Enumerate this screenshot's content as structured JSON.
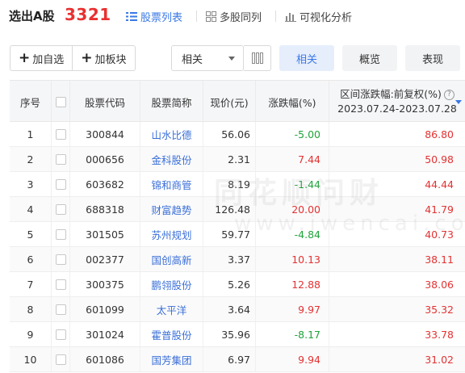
{
  "header": {
    "title": "选出A股",
    "count": "3321",
    "tabs": [
      {
        "label": "股票列表",
        "icon": "list-icon",
        "active": true
      },
      {
        "label": "多股同列",
        "icon": "grid-icon",
        "active": false
      },
      {
        "label": "可视化分析",
        "icon": "bar-chart-icon",
        "active": false
      }
    ]
  },
  "toolbar": {
    "add_watchlist": "加自选",
    "add_sector": "加板块",
    "select_value": "相关",
    "views": [
      "相关",
      "概览",
      "表现"
    ],
    "active_view": "相关"
  },
  "table": {
    "columns": [
      "序号",
      "",
      "股票代码",
      "股票简称",
      "现价(元)",
      "涨跌幅(%)",
      "区间涨跌幅:前复权(%)",
      "2023.07.24-2023.07.28"
    ],
    "rows": [
      {
        "idx": "1",
        "code": "300844",
        "name": "山水比德",
        "price": "56.06",
        "change": "-5.00",
        "range": "86.80"
      },
      {
        "idx": "2",
        "code": "000656",
        "name": "金科股份",
        "price": "2.31",
        "change": "7.44",
        "range": "50.98"
      },
      {
        "idx": "3",
        "code": "603682",
        "name": "锦和商管",
        "price": "8.19",
        "change": "-1.44",
        "range": "44.44"
      },
      {
        "idx": "4",
        "code": "688318",
        "name": "财富趋势",
        "price": "126.48",
        "change": "20.00",
        "range": "41.79"
      },
      {
        "idx": "5",
        "code": "301505",
        "name": "苏州规划",
        "price": "59.77",
        "change": "-4.84",
        "range": "40.73"
      },
      {
        "idx": "6",
        "code": "002377",
        "name": "国创高新",
        "price": "3.37",
        "change": "10.13",
        "range": "38.11"
      },
      {
        "idx": "7",
        "code": "300375",
        "name": "鹏翎股份",
        "price": "5.26",
        "change": "12.88",
        "range": "38.06"
      },
      {
        "idx": "8",
        "code": "601099",
        "name": "太平洋",
        "price": "3.64",
        "change": "9.97",
        "range": "35.32"
      },
      {
        "idx": "9",
        "code": "301024",
        "name": "霍普股份",
        "price": "35.96",
        "change": "-8.17",
        "range": "33.78"
      },
      {
        "idx": "10",
        "code": "601086",
        "name": "国芳集团",
        "price": "6.97",
        "change": "9.94",
        "range": "31.02"
      }
    ]
  },
  "watermark": {
    "line1": "同花顺问财",
    "line2": "www.iwencai.com"
  },
  "colors": {
    "accent": "#3a78e6",
    "up": "#e33232",
    "down": "#1fa33a",
    "count": "#e93030"
  }
}
